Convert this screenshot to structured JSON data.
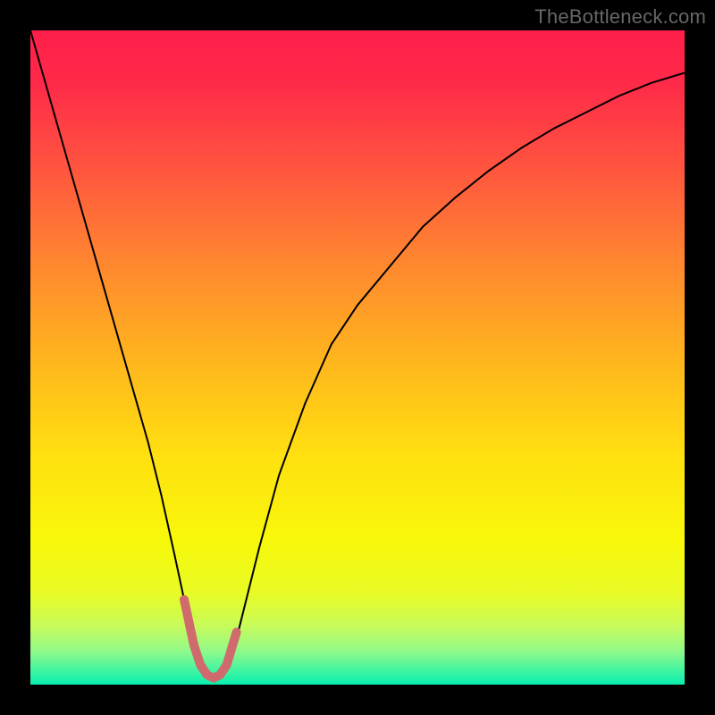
{
  "watermark": "TheBottleneck.com",
  "chart_data": {
    "type": "line",
    "title": "",
    "xlabel": "",
    "ylabel": "",
    "xlim": [
      0,
      100
    ],
    "ylim": [
      0,
      100
    ],
    "background_gradient": {
      "stops": [
        {
          "offset": 0.0,
          "color": "#ff1f4a"
        },
        {
          "offset": 0.08,
          "color": "#ff2a49"
        },
        {
          "offset": 0.2,
          "color": "#ff5140"
        },
        {
          "offset": 0.35,
          "color": "#ff8530"
        },
        {
          "offset": 0.5,
          "color": "#ffb41e"
        },
        {
          "offset": 0.65,
          "color": "#ffe010"
        },
        {
          "offset": 0.78,
          "color": "#f8f80a"
        },
        {
          "offset": 0.86,
          "color": "#e8fb25"
        },
        {
          "offset": 0.91,
          "color": "#c8fb5a"
        },
        {
          "offset": 0.95,
          "color": "#8ef98b"
        },
        {
          "offset": 0.985,
          "color": "#2ff3a6"
        },
        {
          "offset": 1.0,
          "color": "#09efae"
        }
      ]
    },
    "series": [
      {
        "name": "curve",
        "color": "#000000",
        "width": 2,
        "x": [
          0,
          2,
          4,
          6,
          8,
          10,
          12,
          14,
          16,
          18,
          20,
          22,
          23.5,
          25,
          26,
          27,
          28,
          29,
          30,
          31.5,
          33,
          35,
          38,
          42,
          46,
          50,
          55,
          60,
          65,
          70,
          75,
          80,
          85,
          90,
          95,
          100
        ],
        "y": [
          100,
          93,
          86,
          79,
          72,
          65,
          58,
          51,
          44,
          37,
          29,
          20,
          13,
          6,
          3,
          1.5,
          1,
          1.5,
          3,
          7,
          13,
          21,
          32,
          43,
          52,
          58,
          64,
          70,
          74.5,
          78.5,
          82,
          85,
          87.5,
          90,
          92,
          93.5
        ]
      },
      {
        "name": "valley-overlay",
        "color": "#cf6a6d",
        "width": 10,
        "linecap": "round",
        "x": [
          23.5,
          25,
          26,
          27,
          28,
          29,
          30,
          31.5
        ],
        "y": [
          13,
          6,
          3,
          1.5,
          1,
          1.5,
          3,
          8
        ]
      }
    ]
  }
}
